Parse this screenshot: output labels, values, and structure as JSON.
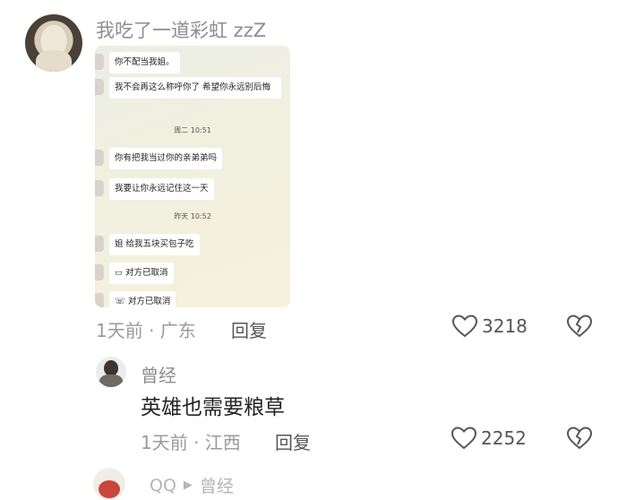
{
  "comment": {
    "username": "我吃了一道彩虹 zzZ",
    "chat_screenshot": {
      "messages": [
        {
          "type": "text",
          "text": "你不配当我姐。"
        },
        {
          "type": "text",
          "text": "我不会再这么称呼你了 希望你永远别后悔"
        },
        {
          "type": "time",
          "text": "周二 10:51"
        },
        {
          "type": "text",
          "text": "你有把我当过你的亲弟弟吗"
        },
        {
          "type": "text",
          "text": "我要让你永远记住这一天"
        },
        {
          "type": "time",
          "text": "昨天 10:52"
        },
        {
          "type": "text",
          "text": "姐 给我五块买包子吃"
        },
        {
          "type": "call",
          "text": "对方已取消",
          "icon": "video-call-icon"
        },
        {
          "type": "call",
          "text": "对方已取消",
          "icon": "phone-icon"
        }
      ]
    },
    "time_location": "1天前 · 广东",
    "reply_label": "回复",
    "likes": "3218"
  },
  "reply": {
    "username": "曾经",
    "text": "英雄也需要粮草",
    "time_location": "1天前 · 江西",
    "reply_label": "回复",
    "likes": "2252"
  },
  "next_reply": {
    "username": "QQ",
    "reply_to": "曾经"
  },
  "colors": {
    "meta_gray": "#9a9a9a",
    "chat_bg": "#f1f0df"
  }
}
